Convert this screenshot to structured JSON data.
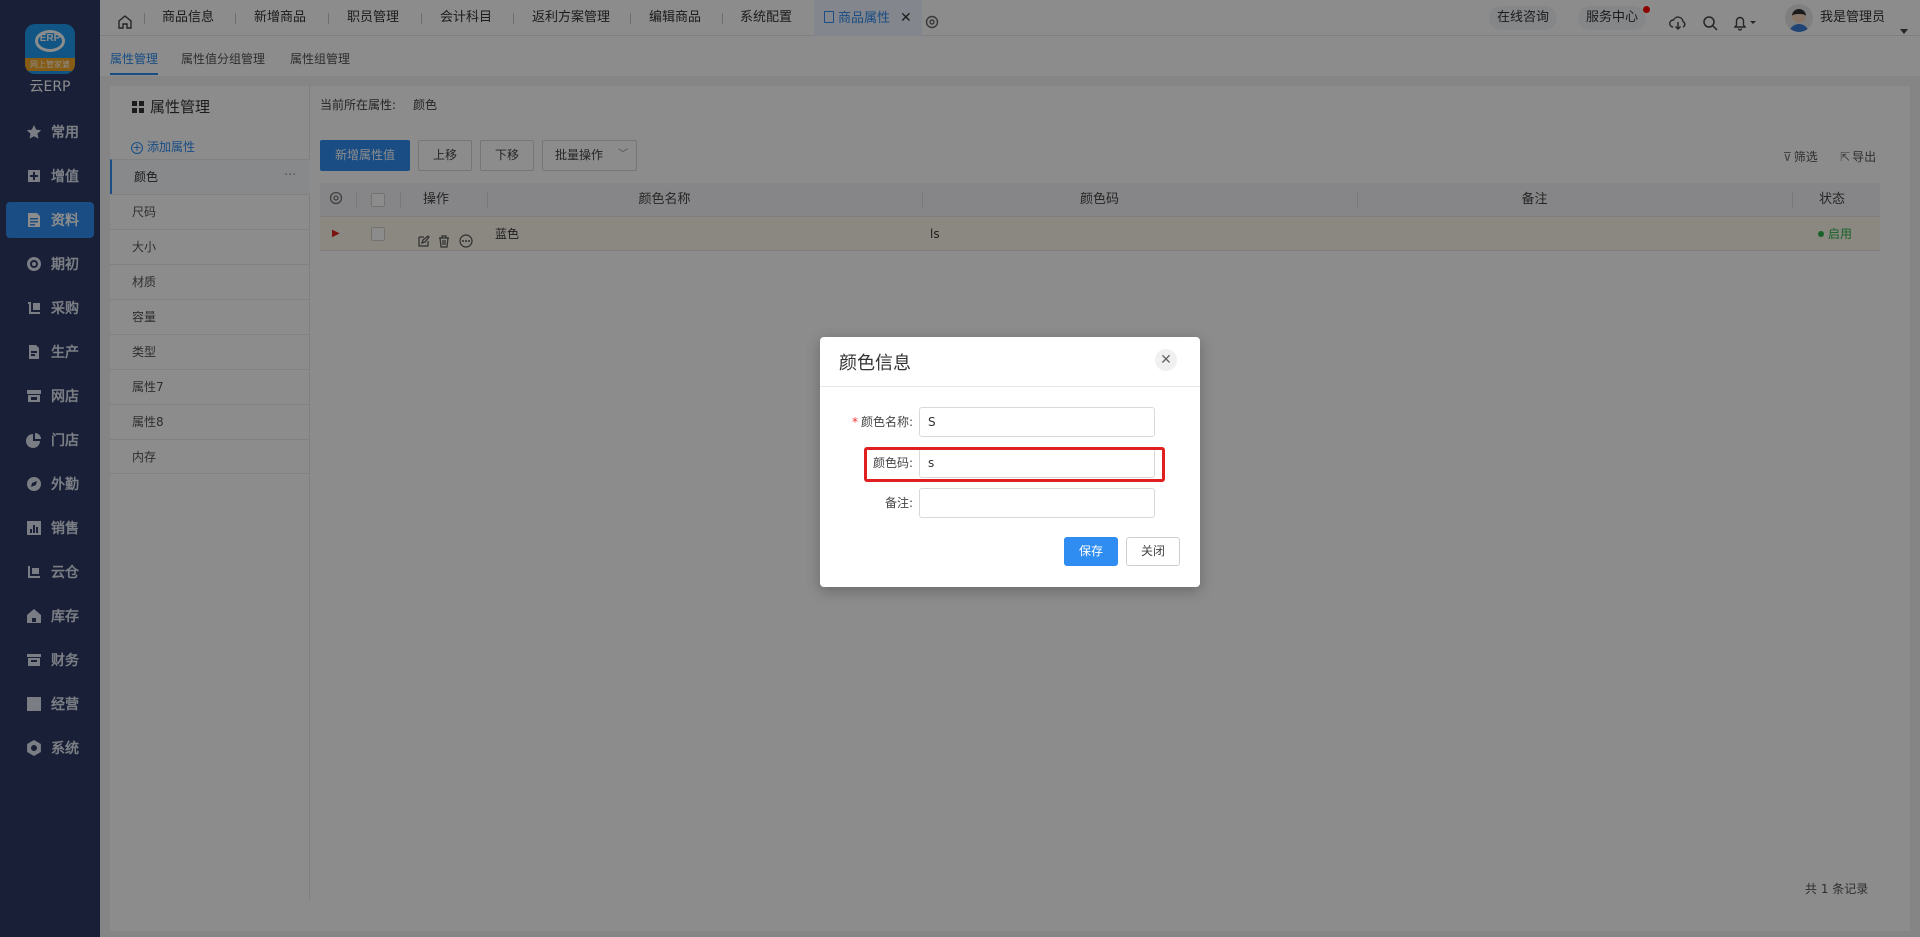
{
  "app": {
    "logo_badge": "网上管家婆",
    "logo_text": "ERP",
    "name": "云ERP"
  },
  "sidebar": {
    "items": [
      {
        "label": "常用",
        "icon": "star-icon"
      },
      {
        "label": "增值",
        "icon": "plus-square-icon"
      },
      {
        "label": "资料",
        "icon": "document-icon",
        "active": true
      },
      {
        "label": "期初",
        "icon": "target-icon"
      },
      {
        "label": "采购",
        "icon": "cart-icon"
      },
      {
        "label": "生产",
        "icon": "factory-icon"
      },
      {
        "label": "网店",
        "icon": "shop-icon"
      },
      {
        "label": "门店",
        "icon": "pie-icon"
      },
      {
        "label": "外勤",
        "icon": "compass-icon"
      },
      {
        "label": "销售",
        "icon": "chart-icon"
      },
      {
        "label": "云仓",
        "icon": "warehouse-icon"
      },
      {
        "label": "库存",
        "icon": "home-icon"
      },
      {
        "label": "财务",
        "icon": "wallet-icon"
      },
      {
        "label": "经营",
        "icon": "trend-icon"
      },
      {
        "label": "系统",
        "icon": "gear-icon"
      }
    ]
  },
  "topbar": {
    "tabs": [
      "商品信息",
      "新增商品",
      "职员管理",
      "会计科目",
      "返利方案管理",
      "编辑商品",
      "系统配置"
    ],
    "active_tab": "商品属性",
    "online_consult": "在线咨询",
    "service_center": "服务中心",
    "user_name": "我是管理员"
  },
  "subtabs": [
    "属性管理",
    "属性值分组管理",
    "属性组管理"
  ],
  "attr_panel": {
    "title": "属性管理",
    "add_label": "添加属性",
    "items": [
      "颜色",
      "尺码",
      "大小",
      "材质",
      "容量",
      "类型",
      "属性7",
      "属性8",
      "内存"
    ]
  },
  "main": {
    "current_label": "当前所在属性:",
    "current_value": "颜色",
    "btn_add": "新增属性值",
    "btn_up": "上移",
    "btn_down": "下移",
    "btn_batch": "批量操作",
    "filter": "筛选",
    "export": "导出",
    "columns": [
      "操作",
      "颜色名称",
      "颜色码",
      "备注",
      "状态"
    ],
    "rows": [
      {
        "name": "蓝色",
        "code": "ls",
        "note": "",
        "status": "启用"
      }
    ],
    "footer": "共 1 条记录"
  },
  "dialog": {
    "title": "颜色信息",
    "fields": [
      {
        "label": "颜色名称:",
        "value": "S",
        "required": true
      },
      {
        "label": "颜色码:",
        "value": "s",
        "required": false
      },
      {
        "label": "备注:",
        "value": "",
        "required": false
      }
    ],
    "save": "保存",
    "close": "关闭"
  },
  "colors": {
    "sidebar": "#2d3a63",
    "accent": "#2f8cf0",
    "highlight": "#e02020",
    "status_on": "#2db34a"
  }
}
